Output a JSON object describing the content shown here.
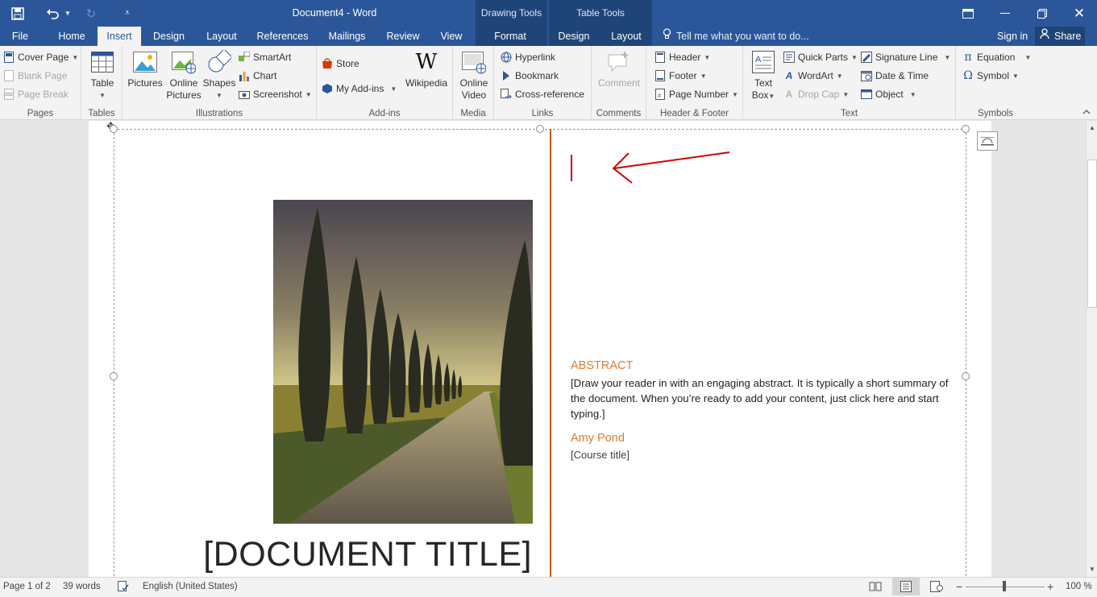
{
  "window": {
    "title": "Document4 - Word",
    "context_groups": [
      "Drawing Tools",
      "Table Tools"
    ]
  },
  "tabs": [
    "File",
    "Home",
    "Insert",
    "Design",
    "Layout",
    "References",
    "Mailings",
    "Review",
    "View",
    "Format",
    "Design",
    "Layout"
  ],
  "active_tab": "Insert",
  "tell_me": "Tell me what you want to do...",
  "sign_in": "Sign in",
  "share": "Share",
  "ribbon": {
    "pages": {
      "label": "Pages",
      "cover_page": "Cover Page",
      "blank_page": "Blank Page",
      "page_break": "Page Break"
    },
    "tables": {
      "label": "Tables",
      "table": "Table"
    },
    "illustrations": {
      "label": "Illustrations",
      "pictures": "Pictures",
      "online_pictures_1": "Online",
      "online_pictures_2": "Pictures",
      "shapes": "Shapes",
      "smartart": "SmartArt",
      "chart": "Chart",
      "screenshot": "Screenshot"
    },
    "addins": {
      "label": "Add-ins",
      "store": "Store",
      "my_addins": "My Add-ins",
      "wikipedia": "Wikipedia"
    },
    "media": {
      "label": "Media",
      "online_video_1": "Online",
      "online_video_2": "Video"
    },
    "links": {
      "label": "Links",
      "hyperlink": "Hyperlink",
      "bookmark": "Bookmark",
      "cross_reference": "Cross-reference"
    },
    "comments": {
      "label": "Comments",
      "comment": "Comment"
    },
    "header_footer": {
      "label": "Header & Footer",
      "header": "Header",
      "footer": "Footer",
      "page_number": "Page Number"
    },
    "text": {
      "label": "Text",
      "text_box_1": "Text",
      "text_box_2": "Box",
      "quick_parts": "Quick Parts",
      "wordart": "WordArt",
      "drop_cap": "Drop Cap",
      "signature_line": "Signature Line",
      "date_time": "Date & Time",
      "object": "Object"
    },
    "symbols": {
      "label": "Symbols",
      "equation": "Equation",
      "symbol": "Symbol"
    }
  },
  "document": {
    "title_placeholder": "[DOCUMENT TITLE]",
    "abstract_heading": "ABSTRACT",
    "abstract_body": "[Draw your reader in with an engaging abstract. It is typically a short summary of the document. When you’re ready to add your content, just click here and start typing.]",
    "author": "Amy Pond",
    "course": "[Course title]"
  },
  "status": {
    "page": "Page 1 of 2",
    "words": "39 words",
    "language": "English (United States)",
    "zoom": "100 %"
  },
  "colors": {
    "word_blue": "#2b579a",
    "accent_orange": "#e07b31",
    "annotation_red": "#d40000"
  }
}
